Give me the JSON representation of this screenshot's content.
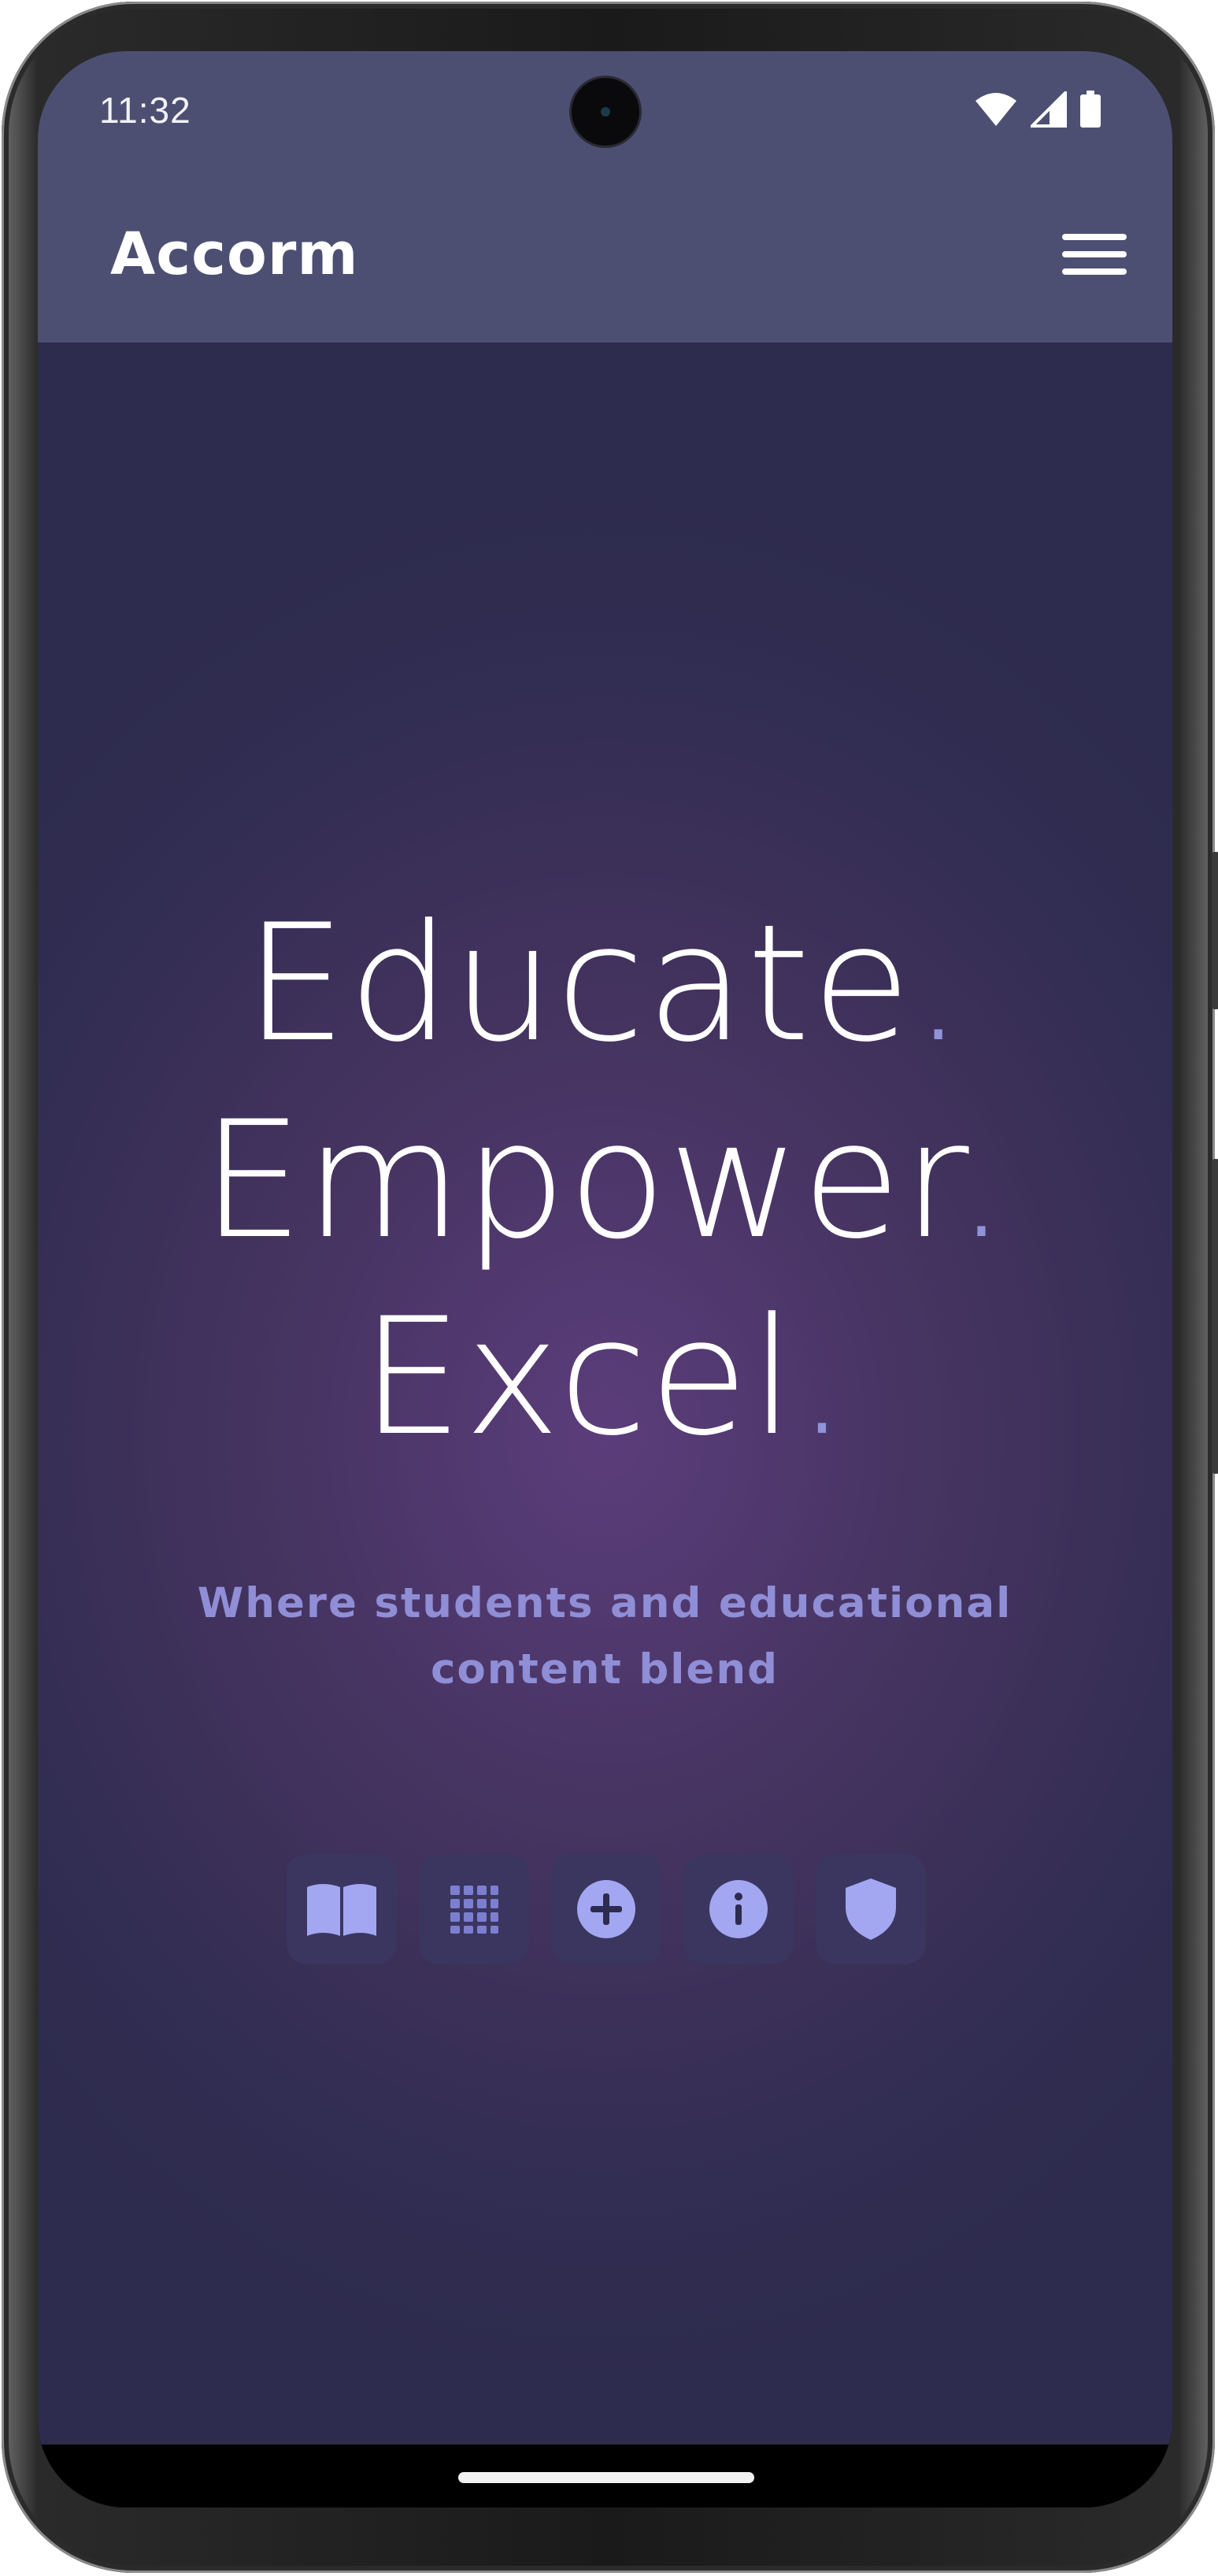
{
  "status_bar": {
    "time": "11:32",
    "icons": [
      "wifi-icon",
      "cellular-signal-icon",
      "battery-icon"
    ]
  },
  "app_bar": {
    "title": "Accorm",
    "menu_icon": "hamburger-menu-icon"
  },
  "hero": {
    "headline_lines": [
      "Educate",
      "Empower",
      "Excel"
    ],
    "headline_punctuation": ".",
    "tagline": "Where students and educational content blend"
  },
  "quick_actions": [
    {
      "icon": "book-open-icon"
    },
    {
      "icon": "grid-icon"
    },
    {
      "icon": "plus-circle-icon"
    },
    {
      "icon": "info-icon"
    },
    {
      "icon": "shield-icon"
    }
  ],
  "colors": {
    "app_bar": "#4d4f72",
    "background": "#3a2f5a",
    "accent": "#8f93d8",
    "icon_fill": "#a3a6f0",
    "icon_button_bg": "#3a3660",
    "text": "#ffffff"
  }
}
